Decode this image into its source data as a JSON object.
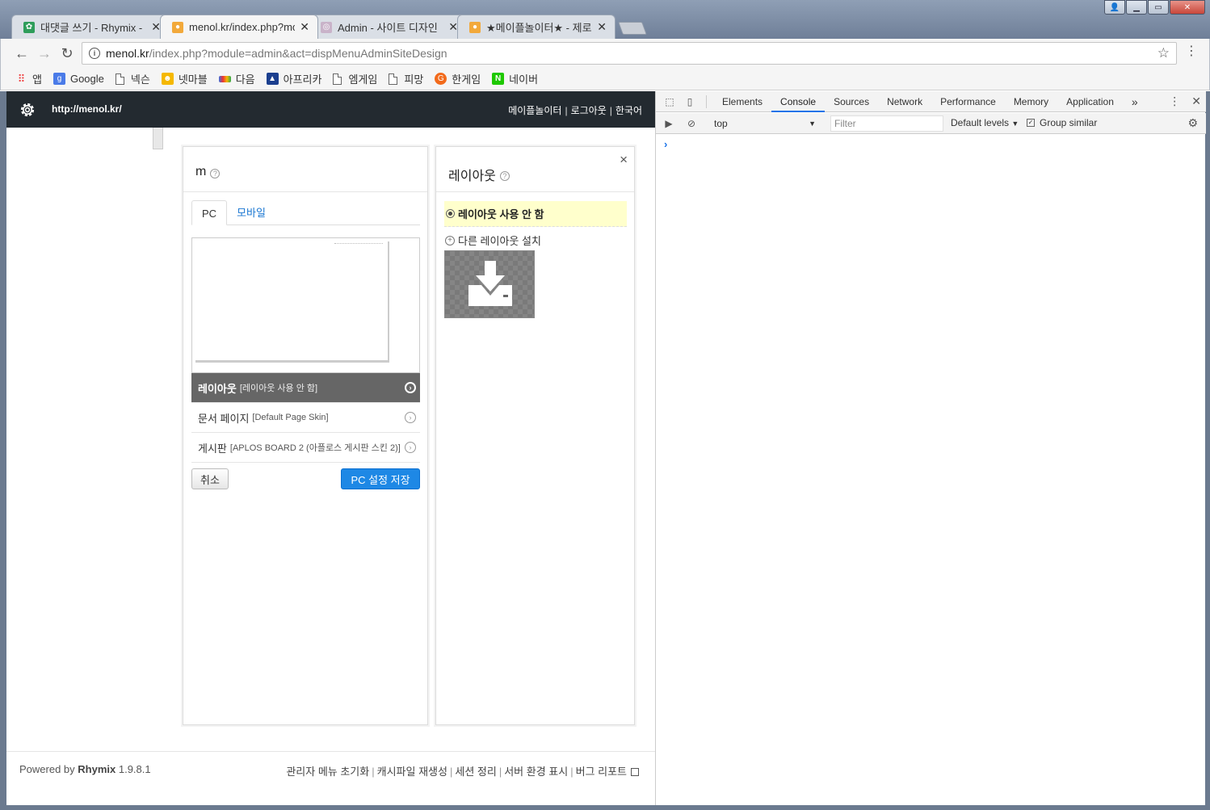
{
  "browser": {
    "tabs": [
      {
        "title": "대댓글 쓰기 - Rhymix - ",
        "favicon_color": "#2e9d5a"
      },
      {
        "title": "menol.kr/index.php?mod",
        "favicon_color": "#f2a93b"
      },
      {
        "title": "Admin - 사이트 디자인 ",
        "favicon_color": "#c9b3c9"
      },
      {
        "title": "★메이플놀이터★ - 제로",
        "favicon_color": "#f2a93b"
      }
    ],
    "url_host": "menol.kr",
    "url_path": "/index.php?module=admin&act=dispMenuAdminSiteDesign",
    "bookmarks": [
      {
        "label": "앱",
        "icon": "apps-grid-icon"
      },
      {
        "label": "Google",
        "icon": "google-icon"
      },
      {
        "label": "넥슨",
        "icon": "page-icon"
      },
      {
        "label": "넷마블",
        "icon": "netmarble-icon"
      },
      {
        "label": "다음",
        "icon": "daum-icon"
      },
      {
        "label": "아프리카",
        "icon": "afreeca-icon"
      },
      {
        "label": "엠게임",
        "icon": "page-icon"
      },
      {
        "label": "피망",
        "icon": "page-icon"
      },
      {
        "label": "한게임",
        "icon": "hangame-icon"
      },
      {
        "label": "네이버",
        "icon": "naver-icon"
      }
    ]
  },
  "admin": {
    "site_url": "http://menol.kr/",
    "header_links": [
      "메이플놀이터",
      "로그아웃",
      "한국어"
    ]
  },
  "left_panel": {
    "title": "m",
    "tabs": [
      "PC",
      "모바일"
    ],
    "rows": [
      {
        "label": "레이아웃",
        "sub": "[레이아웃 사용 안 함]"
      },
      {
        "label": "문서 페이지",
        "sub": "[Default Page Skin]"
      },
      {
        "label": "게시판",
        "sub": "[APLOS BOARD 2 (아플로스 게시판 스킨 2)]"
      }
    ],
    "cancel_label": "취소",
    "save_label": "PC 설정 저장"
  },
  "right_panel": {
    "title": "레이아웃",
    "close": "×",
    "option_selected": "레이아웃 사용 안 함",
    "install_other": "다른 레이아웃 설치"
  },
  "footer": {
    "powered_prefix": "Powered by ",
    "powered_brand": "Rhymix",
    "version": " 1.9.8.1",
    "links": [
      "관리자 메뉴 초기화",
      "캐시파일 재생성",
      "세션 정리",
      "서버 환경 표시",
      "버그 리포트"
    ]
  },
  "devtools": {
    "tabs": [
      "Elements",
      "Console",
      "Sources",
      "Network",
      "Performance",
      "Memory",
      "Application"
    ],
    "active_tab": "Console",
    "context": "top",
    "filter_placeholder": "Filter",
    "levels": "Default levels",
    "group_similar": "Group similar",
    "prompt": "›"
  },
  "colors": {
    "admin_header": "#232a30",
    "save_button": "#1e88e5",
    "selected_row": "#666666",
    "highlight_option": "#ffffcc",
    "devtools_accent": "#1a73e8"
  }
}
